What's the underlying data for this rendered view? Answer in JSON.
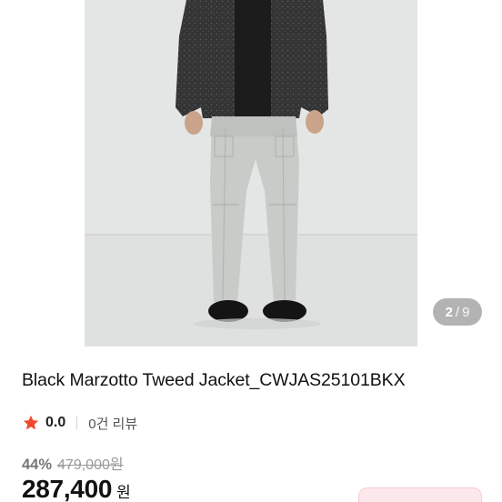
{
  "product": {
    "title": "Black Marzotto Tweed Jacket_CWJAS25101BKX",
    "image_alt": "product-photo"
  },
  "gallery": {
    "current": "2",
    "separator": "/",
    "total": "9"
  },
  "rating": {
    "value": "0.0",
    "review_count_text": "0건 리뷰",
    "star_color": "#f04a2e"
  },
  "price": {
    "discount_rate": "44%",
    "original_price": "479,000원",
    "sale_price": "287,400",
    "currency": "원"
  },
  "colors": {
    "accent_pink": "#fde8ec"
  }
}
